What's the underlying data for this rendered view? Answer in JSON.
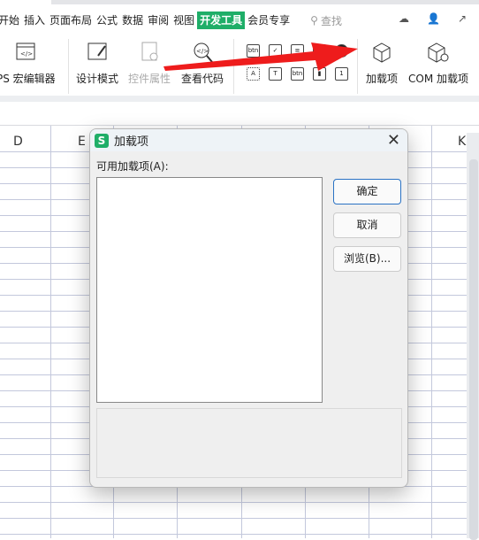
{
  "tabs": [
    "开始",
    "插入",
    "页面布局",
    "公式",
    "数据",
    "审阅",
    "视图",
    "开发工具",
    "会员专享"
  ],
  "active_tab": "开发工具",
  "search_label": "查找",
  "ribbon": {
    "macro_editor": "PS 宏编辑器",
    "design_mode": "设计模式",
    "control_props": "控件属性",
    "view_code": "查看代码",
    "addins": "加载项",
    "com_addins": "COM 加载项"
  },
  "controls": {
    "btn": "btn",
    "label": "A",
    "text": "T",
    "btn2": "btn",
    "spin": "1"
  },
  "columns": {
    "d": "D",
    "e": "E",
    "k": "K"
  },
  "dialog": {
    "title": "加载项",
    "list_label": "可用加载项(A):",
    "ok": "确定",
    "cancel": "取消",
    "browse": "浏览(B)...",
    "close": "✕"
  },
  "colors": {
    "accent": "#1fae68",
    "arrow": "#ee1c1c",
    "primary_border": "#2a72c4"
  }
}
